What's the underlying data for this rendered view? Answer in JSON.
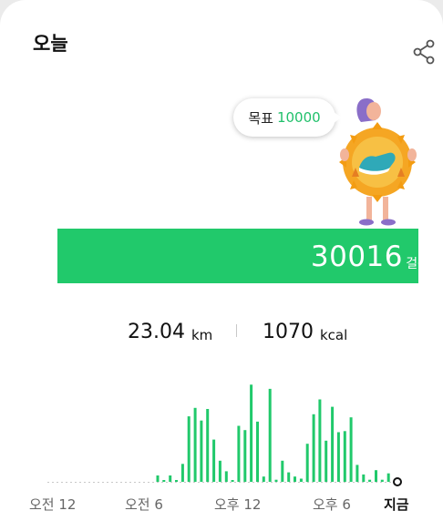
{
  "header": {
    "title": "오늘"
  },
  "goal": {
    "label": "목표",
    "value": "10000"
  },
  "steps": {
    "count": "30016",
    "unit": "걸음"
  },
  "stats": {
    "distance_value": "23.04",
    "distance_unit": "km",
    "calories_value": "1070",
    "calories_unit": "kcal"
  },
  "colors": {
    "accent": "#21c96b",
    "bubble_goal": "#21c06b"
  },
  "icons": {
    "share": "share-icon",
    "mascot": "walking-mascot-illustration"
  },
  "chart_data": {
    "type": "bar",
    "x_tick_labels": [
      "오전 12",
      "오전 6",
      "오후 12",
      "오후 6",
      "지금"
    ],
    "note_units": "relative hourly step bars (0-1 of chart max)",
    "values": [
      0.06,
      0.01,
      0.06,
      0.01,
      0.17,
      0.62,
      0.7,
      0.58,
      0.69,
      0.4,
      0.2,
      0.1,
      0.01,
      0.53,
      0.49,
      0.92,
      0.57,
      0.05,
      0.88,
      0.02,
      0.2,
      0.09,
      0.05,
      0.03,
      0.36,
      0.64,
      0.78,
      0.39,
      0.71,
      0.47,
      0.48,
      0.61,
      0.16,
      0.07,
      0.02,
      0.11,
      0.02,
      0.08,
      0.02
    ],
    "grid": false,
    "legend": "none"
  }
}
